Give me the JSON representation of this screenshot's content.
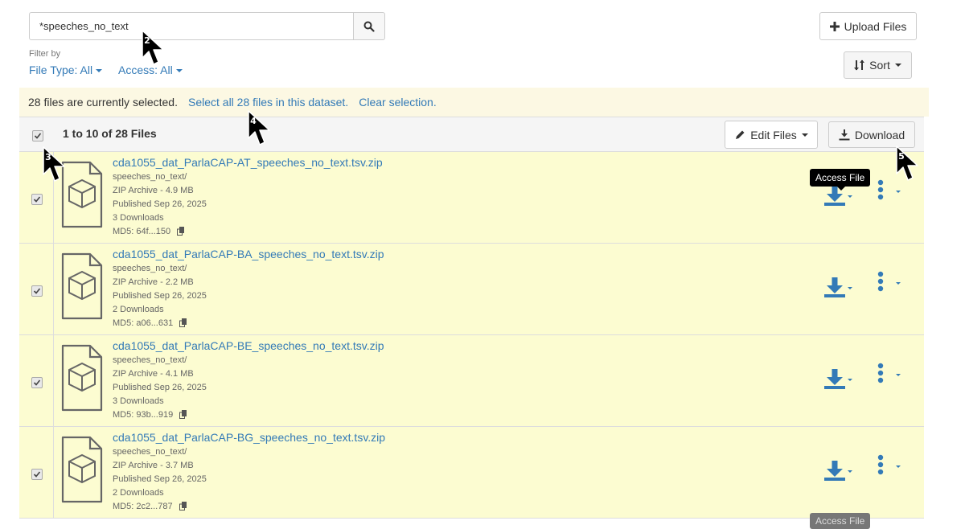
{
  "search": {
    "value": "*speeches_no_text"
  },
  "filter": {
    "label": "Filter by",
    "file_type": "File Type: All",
    "access": "Access: All"
  },
  "toolbar": {
    "upload_label": "Upload Files",
    "sort_label": "Sort",
    "edit_label": "Edit Files",
    "download_label": "Download"
  },
  "selection": {
    "message": "28 files are currently selected.",
    "select_all": "Select all 28 files in this dataset.",
    "clear": "Clear selection."
  },
  "table": {
    "count_label": "1 to 10 of 28 Files"
  },
  "files": [
    {
      "name": "cda1055_dat_ParlaCAP-AT_speeches_no_text.tsv.zip",
      "path": "speeches_no_text/",
      "type_size": "ZIP Archive - 4.9 MB",
      "published": "Published Sep 26, 2025",
      "downloads": "3 Downloads",
      "md5": "MD5: 64f...150"
    },
    {
      "name": "cda1055_dat_ParlaCAP-BA_speeches_no_text.tsv.zip",
      "path": "speeches_no_text/",
      "type_size": "ZIP Archive - 2.2 MB",
      "published": "Published Sep 26, 2025",
      "downloads": "2 Downloads",
      "md5": "MD5: a06...631"
    },
    {
      "name": "cda1055_dat_ParlaCAP-BE_speeches_no_text.tsv.zip",
      "path": "speeches_no_text/",
      "type_size": "ZIP Archive - 4.1 MB",
      "published": "Published Sep 26, 2025",
      "downloads": "3 Downloads",
      "md5": "MD5: 93b...919"
    },
    {
      "name": "cda1055_dat_ParlaCAP-BG_speeches_no_text.tsv.zip",
      "path": "speeches_no_text/",
      "type_size": "ZIP Archive - 3.7 MB",
      "published": "Published Sep 26, 2025",
      "downloads": "2 Downloads",
      "md5": "MD5: 2c2...787"
    }
  ],
  "tooltip": {
    "access_file": "Access File"
  },
  "cursors": [
    "2",
    "3",
    "4",
    "5"
  ],
  "colors": {
    "link": "#337ab7",
    "selected_row": "#fcfcd1",
    "banner": "#fcf8e3"
  }
}
